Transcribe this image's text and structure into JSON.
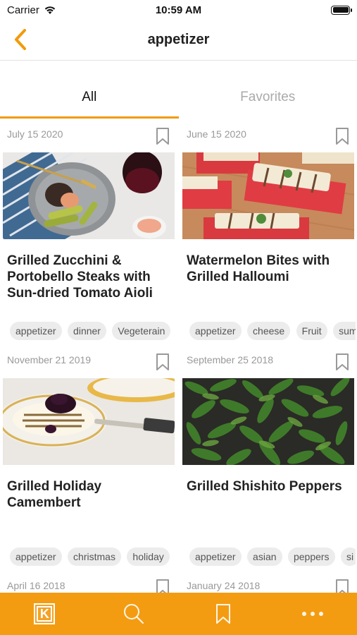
{
  "status": {
    "carrier": "Carrier",
    "time": "10:59 AM"
  },
  "nav": {
    "title": "appetizer",
    "back_icon": "chevron-left-icon"
  },
  "tabs": [
    {
      "label": "All",
      "selected": true
    },
    {
      "label": "Favorites",
      "selected": false
    }
  ],
  "recipes": [
    {
      "date": "July 15 2020",
      "title": "Grilled Zucchini & Portobello Steaks with Sun-dried Tomato Aioli",
      "tags": [
        "appetizer",
        "dinner",
        "Vegeterain"
      ],
      "image": "grilled-zucchini-plate"
    },
    {
      "date": "June 15 2020",
      "title": "Watermelon Bites with Grilled Halloumi",
      "tags": [
        "appetizer",
        "cheese",
        "Fruit",
        "sum"
      ],
      "image": "watermelon-halloumi"
    },
    {
      "date": "November 21 2019",
      "title": "Grilled Holiday Camembert",
      "tags": [
        "appetizer",
        "christmas",
        "holiday"
      ],
      "image": "grilled-camembert"
    },
    {
      "date": "September 25 2018",
      "title": "Grilled Shishito Peppers",
      "tags": [
        "appetizer",
        "asian",
        "peppers",
        "si"
      ],
      "image": "shishito-peppers"
    },
    {
      "date": "April 16 2018",
      "title": "",
      "tags": [],
      "image": ""
    },
    {
      "date": "January 24 2018",
      "title": "",
      "tags": [],
      "image": ""
    }
  ],
  "tab_bar": {
    "items": [
      "k-logo-icon",
      "search-icon",
      "bookmark-icon",
      "more-icon"
    ],
    "color": "#f39c12"
  },
  "colors": {
    "accent": "#f29a0b"
  }
}
